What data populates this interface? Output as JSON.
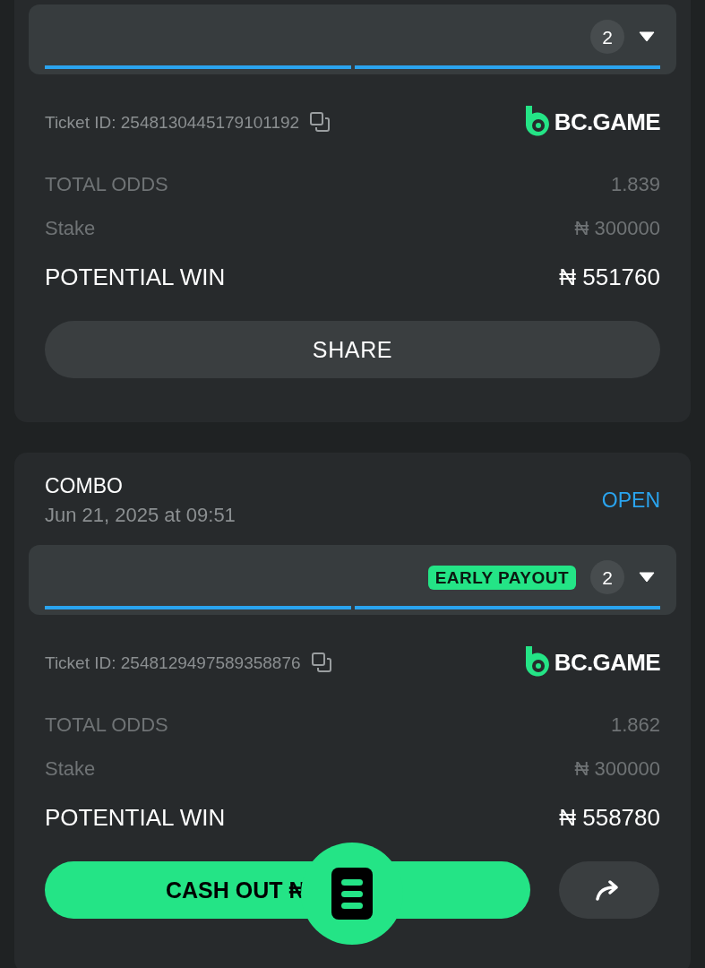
{
  "tickets": [
    {
      "legs_count": "2",
      "progress": [
        {
          "level": 1
        },
        {
          "level": 1
        }
      ],
      "ticket_id": "Ticket ID: 2548130445179101192",
      "brand": "BC.GAME",
      "total_odds_label": "TOTAL ODDS",
      "total_odds": "1.839",
      "stake_label": "Stake",
      "stake": "₦ 300000",
      "potential_label": "POTENTIAL WIN",
      "potential": "₦ 551760",
      "action": {
        "kind": "share",
        "label": "SHARE"
      }
    },
    {
      "header": {
        "type": "COMBO",
        "date": "Jun 21, 2025 at 09:51",
        "status": "OPEN"
      },
      "legs_count": "2",
      "early_payout": "EARLY PAYOUT",
      "progress": [
        {
          "level": 1
        },
        {
          "level": 1
        }
      ],
      "ticket_id": "Ticket ID: 2548129497589358876",
      "brand": "BC.GAME",
      "total_odds_label": "TOTAL ODDS",
      "total_odds": "1.862",
      "stake_label": "Stake",
      "stake": "₦ 300000",
      "potential_label": "POTENTIAL WIN",
      "potential": "₦ 558780",
      "action": {
        "kind": "cashout",
        "label": "CASH OUT ₦"
      }
    }
  ]
}
